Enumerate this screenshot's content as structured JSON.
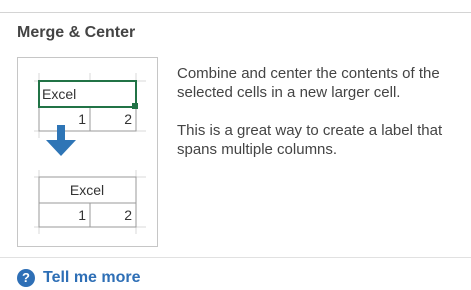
{
  "panel": {
    "title": "Merge & Center",
    "description_1": "Combine and center the contents of the selected cells in a new larger cell.",
    "description_2": "This is a great way to create a label that spans multiple columns."
  },
  "preview": {
    "before_label": "Excel",
    "before_values": [
      "1",
      "2"
    ],
    "after_label": "Excel",
    "after_values": [
      "1",
      "2"
    ],
    "selection_color": "#217346",
    "arrow_color": "#2e75b6"
  },
  "help": {
    "icon": "question-circle-icon",
    "label": "Tell me more"
  }
}
